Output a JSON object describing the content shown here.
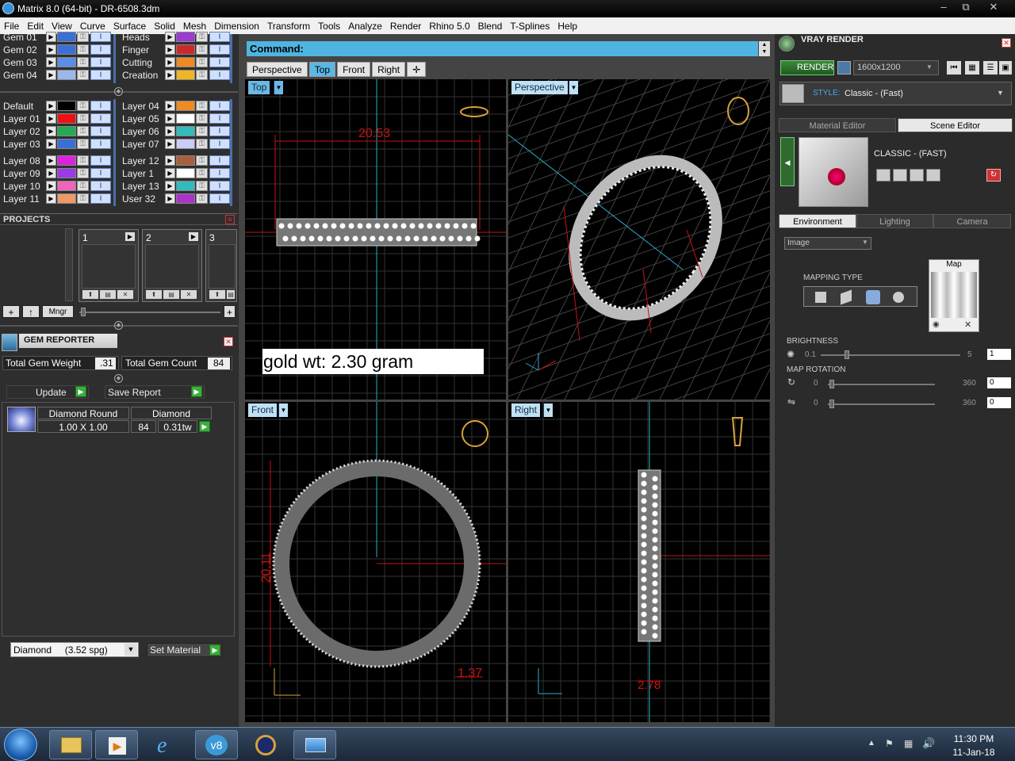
{
  "window": {
    "title": "Matrix 8.0 (64-bit) - DR-6508.3dm",
    "btn_min": "‒",
    "btn_max": "⧉",
    "btn_close": "✕"
  },
  "menu": [
    "File",
    "Edit",
    "View",
    "Curve",
    "Surface",
    "Solid",
    "Mesh",
    "Dimension",
    "Transform",
    "Tools",
    "Analyze",
    "Render",
    "Rhino 5.0",
    "Blend",
    "T-Splines",
    "Help"
  ],
  "layers": {
    "top_left": [
      {
        "name": "Gem 01",
        "color": "#3a6fd6"
      },
      {
        "name": "Gem 02",
        "color": "#3a6fd6"
      },
      {
        "name": "Gem 03",
        "color": "#5a8ee6"
      },
      {
        "name": "Gem 04",
        "color": "#9ab8ee"
      }
    ],
    "top_right": [
      {
        "name": "Heads",
        "color": "#9a3dd0"
      },
      {
        "name": "Finger",
        "color": "#cc2a2a"
      },
      {
        "name": "Cutting",
        "color": "#ee8a22"
      },
      {
        "name": "Creation",
        "color": "#eeb622"
      }
    ],
    "mid_left": [
      {
        "name": "Default",
        "color": "#000000"
      },
      {
        "name": "Layer 01",
        "color": "#ee1111"
      },
      {
        "name": "Layer 02",
        "color": "#22aa55"
      },
      {
        "name": "Layer 03",
        "color": "#3a6fd6"
      },
      {
        "name": "Layer 08",
        "color": "#dd22dd"
      },
      {
        "name": "Layer 09",
        "color": "#9b3ae6"
      },
      {
        "name": "Layer 10",
        "color": "#ee66bb"
      },
      {
        "name": "Layer 11",
        "color": "#ee9966"
      }
    ],
    "mid_right": [
      {
        "name": "Layer 04",
        "color": "#ee8a22"
      },
      {
        "name": "Layer 05",
        "color": "#ffffff"
      },
      {
        "name": "Layer 06",
        "color": "#33bbbb"
      },
      {
        "name": "Layer 07",
        "color": "#ccccf6"
      },
      {
        "name": "Layer 12",
        "color": "#a9603a"
      },
      {
        "name": "Layer 1",
        "color": "#ffffff"
      },
      {
        "name": "Layer 13",
        "color": "#33bbbb"
      },
      {
        "name": "User 32",
        "color": "#aa33cc"
      }
    ],
    "btn_arrow": "▶",
    "lock": "🔒"
  },
  "projects": {
    "title": "PROJECTS",
    "slots": [
      "1",
      "2",
      "3"
    ],
    "btn_add": "+",
    "btn_up": "↑",
    "btn_mngr": "Mngr",
    "btn_plus": "+"
  },
  "gem_reporter": {
    "title": "GEM REPORTER",
    "total_weight_label": "Total Gem Weight",
    "total_weight_value": ".31",
    "total_count_label": "Total Gem Count",
    "total_count_value": "84",
    "update_label": "Update",
    "save_report_label": "Save Report",
    "row": {
      "shape": "Diamond Round",
      "size": "1.00 X 1.00",
      "material": "Diamond",
      "count": "84",
      "weight": "0.31tw"
    },
    "material_select": "Diamond     (3.52 spg)",
    "set_material_label": "Set Material"
  },
  "command": {
    "label": "Command:"
  },
  "view_tabs": [
    "Perspective",
    "Top",
    "Front",
    "Right"
  ],
  "view_tab_active": 1,
  "viewports": {
    "top": {
      "label": "Top",
      "dim": "20.53",
      "note": "gold wt: 2.30 gram"
    },
    "perspective": {
      "label": "Perspective"
    },
    "front": {
      "label": "Front",
      "dim_v": "20.11",
      "dim_h": "1.37"
    },
    "right": {
      "label": "Right",
      "dim": "2.78"
    }
  },
  "vray": {
    "title": "VRAY RENDER",
    "render_label": "RENDER",
    "resolution": "1600x1200",
    "style_label": "STYLE:",
    "style_value": "Classic - (Fast)",
    "tabs": [
      "Material Editor",
      "Scene Editor"
    ],
    "preset_name": "CLASSIC - (FAST)",
    "env_tabs": [
      "Environment",
      "Lighting",
      "Camera"
    ],
    "env_select": "Image",
    "map_label": "Map",
    "mapping_type_label": "MAPPING TYPE",
    "brightness_label": "BRIGHTNESS",
    "brightness_min": "0.1",
    "brightness_max": "5",
    "brightness_value": "1",
    "map_rotation_label": "MAP ROTATION",
    "rot1_min": "0",
    "rot1_max": "360",
    "rot1_value": "0",
    "rot2_min": "0",
    "rot2_max": "360",
    "rot2_value": "0"
  },
  "taskbar": {
    "time": "11:30 PM",
    "date": "11-Jan-18",
    "v8_label": "v8"
  }
}
